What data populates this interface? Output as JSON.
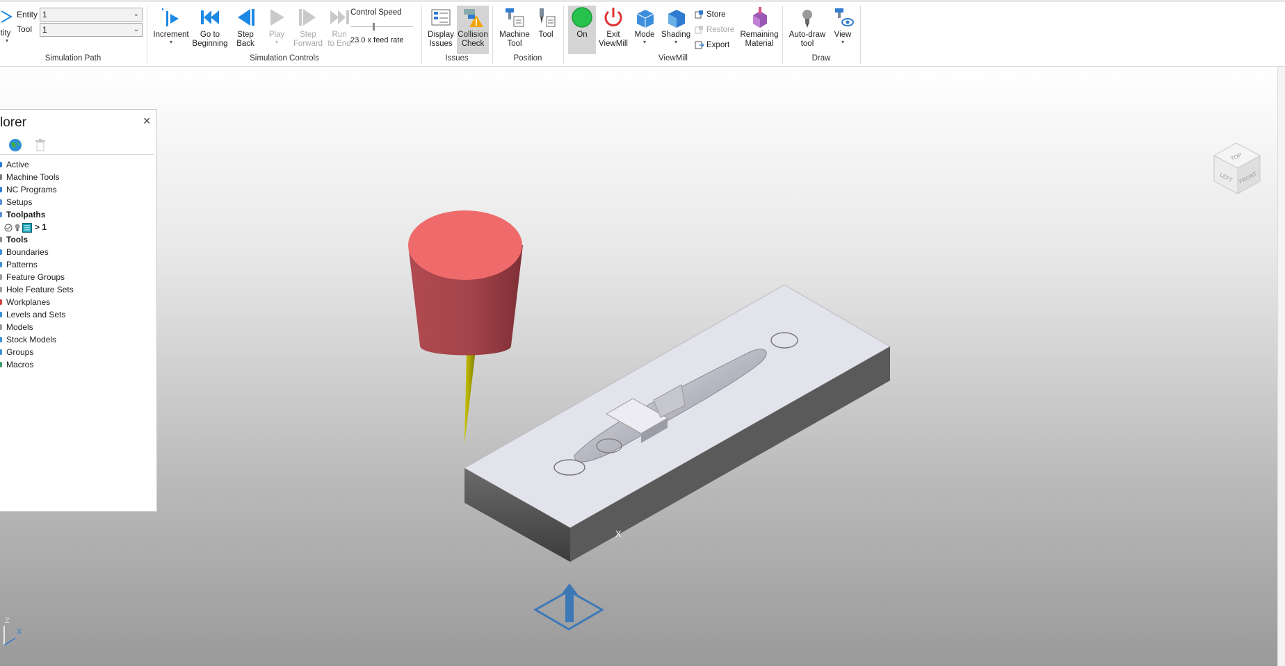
{
  "simulation_path": {
    "truncated_button": "tity",
    "entity_label": "Entity",
    "entity_value": "1",
    "tool_label": "Tool",
    "tool_value": "1",
    "group_label": "Simulation Path"
  },
  "simulation_controls": {
    "increment": "Increment",
    "go_to_beginning_1": "Go to",
    "go_to_beginning_2": "Beginning",
    "step_back_1": "Step",
    "step_back_2": "Back",
    "play": "Play",
    "step_forward_1": "Step",
    "step_forward_2": "Forward",
    "run_to_end_1": "Run",
    "run_to_end_2": "to End",
    "control_speed": "Control Speed",
    "feed_rate": "23.0 x feed rate",
    "group_label": "Simulation Controls"
  },
  "issues": {
    "display_issues_1": "Display",
    "display_issues_2": "Issues",
    "collision_check_1": "Collision",
    "collision_check_2": "Check",
    "group_label": "Issues"
  },
  "position": {
    "machine_tool_1": "Machine",
    "machine_tool_2": "Tool",
    "tool": "Tool",
    "group_label": "Position"
  },
  "viewmill": {
    "on": "On",
    "exit_1": "Exit",
    "exit_2": "ViewMill",
    "mode": "Mode",
    "shading": "Shading",
    "store": "Store",
    "restore": "Restore",
    "export": "Export",
    "remaining_1": "Remaining",
    "remaining_2": "Material",
    "group_label": "ViewMill"
  },
  "draw": {
    "auto_draw_1": "Auto-draw",
    "auto_draw_2": "tool",
    "view": "View",
    "group_label": "Draw"
  },
  "explorer": {
    "title": "lorer",
    "active_row_label": "> 1",
    "items": [
      {
        "label": "Active",
        "bold": false,
        "color": "#2e7bd1"
      },
      {
        "label": "Machine Tools",
        "bold": false,
        "color": "#7a7a7a"
      },
      {
        "label": "NC Programs",
        "bold": false,
        "color": "#2e7bd1"
      },
      {
        "label": "Setups",
        "bold": false,
        "color": "#5a8fd8"
      },
      {
        "label": "Toolpaths",
        "bold": true,
        "color": "#5a8fd8"
      },
      {
        "label": "Tools",
        "bold": true,
        "color": "#888888"
      },
      {
        "label": "Boundaries",
        "bold": false,
        "color": "#3a8fd8"
      },
      {
        "label": "Patterns",
        "bold": false,
        "color": "#3a8fd8"
      },
      {
        "label": "Feature Groups",
        "bold": false,
        "color": "#9a9a9a"
      },
      {
        "label": "Hole Feature Sets",
        "bold": false,
        "color": "#9a9a9a"
      },
      {
        "label": "Workplanes",
        "bold": false,
        "color": "#d04040"
      },
      {
        "label": "Levels and Sets",
        "bold": false,
        "color": "#3a8fd8"
      },
      {
        "label": "Models",
        "bold": false,
        "color": "#9a9a9a"
      },
      {
        "label": "Stock Models",
        "bold": false,
        "color": "#3a8fd8"
      },
      {
        "label": "Groups",
        "bold": false,
        "color": "#3a8fd8"
      },
      {
        "label": "Macros",
        "bold": false,
        "color": "#3a9a6a"
      }
    ]
  },
  "viewcube": {
    "top": "TOP",
    "left": "LEFT",
    "front": "FRONT"
  },
  "axes": {
    "z": "Z",
    "x": "X"
  },
  "colors": {
    "accent": "#1e88e5",
    "tool_top": "#ef6b6b",
    "tool_body": "#a8454a",
    "tool_tip": "#b7b500",
    "part": "#e2e3ea",
    "on_indicator": "#27c24c"
  }
}
